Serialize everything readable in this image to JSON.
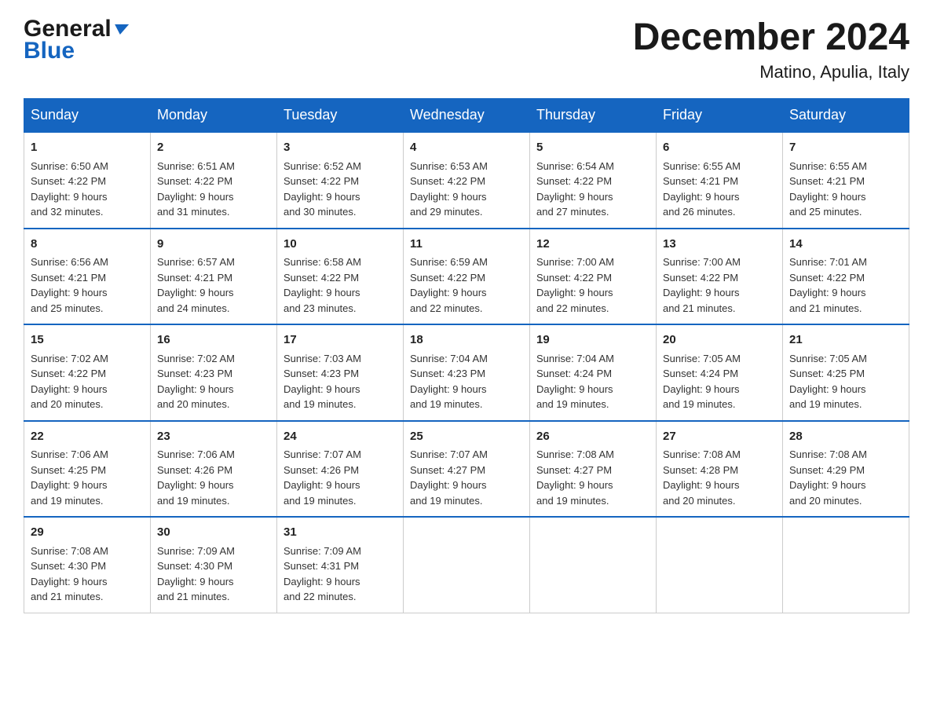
{
  "logo": {
    "line1": "General",
    "line2": "Blue"
  },
  "title": "December 2024",
  "location": "Matino, Apulia, Italy",
  "days_header": [
    "Sunday",
    "Monday",
    "Tuesday",
    "Wednesday",
    "Thursday",
    "Friday",
    "Saturday"
  ],
  "weeks": [
    [
      {
        "day": "1",
        "info": "Sunrise: 6:50 AM\nSunset: 4:22 PM\nDaylight: 9 hours\nand 32 minutes."
      },
      {
        "day": "2",
        "info": "Sunrise: 6:51 AM\nSunset: 4:22 PM\nDaylight: 9 hours\nand 31 minutes."
      },
      {
        "day": "3",
        "info": "Sunrise: 6:52 AM\nSunset: 4:22 PM\nDaylight: 9 hours\nand 30 minutes."
      },
      {
        "day": "4",
        "info": "Sunrise: 6:53 AM\nSunset: 4:22 PM\nDaylight: 9 hours\nand 29 minutes."
      },
      {
        "day": "5",
        "info": "Sunrise: 6:54 AM\nSunset: 4:22 PM\nDaylight: 9 hours\nand 27 minutes."
      },
      {
        "day": "6",
        "info": "Sunrise: 6:55 AM\nSunset: 4:21 PM\nDaylight: 9 hours\nand 26 minutes."
      },
      {
        "day": "7",
        "info": "Sunrise: 6:55 AM\nSunset: 4:21 PM\nDaylight: 9 hours\nand 25 minutes."
      }
    ],
    [
      {
        "day": "8",
        "info": "Sunrise: 6:56 AM\nSunset: 4:21 PM\nDaylight: 9 hours\nand 25 minutes."
      },
      {
        "day": "9",
        "info": "Sunrise: 6:57 AM\nSunset: 4:21 PM\nDaylight: 9 hours\nand 24 minutes."
      },
      {
        "day": "10",
        "info": "Sunrise: 6:58 AM\nSunset: 4:22 PM\nDaylight: 9 hours\nand 23 minutes."
      },
      {
        "day": "11",
        "info": "Sunrise: 6:59 AM\nSunset: 4:22 PM\nDaylight: 9 hours\nand 22 minutes."
      },
      {
        "day": "12",
        "info": "Sunrise: 7:00 AM\nSunset: 4:22 PM\nDaylight: 9 hours\nand 22 minutes."
      },
      {
        "day": "13",
        "info": "Sunrise: 7:00 AM\nSunset: 4:22 PM\nDaylight: 9 hours\nand 21 minutes."
      },
      {
        "day": "14",
        "info": "Sunrise: 7:01 AM\nSunset: 4:22 PM\nDaylight: 9 hours\nand 21 minutes."
      }
    ],
    [
      {
        "day": "15",
        "info": "Sunrise: 7:02 AM\nSunset: 4:22 PM\nDaylight: 9 hours\nand 20 minutes."
      },
      {
        "day": "16",
        "info": "Sunrise: 7:02 AM\nSunset: 4:23 PM\nDaylight: 9 hours\nand 20 minutes."
      },
      {
        "day": "17",
        "info": "Sunrise: 7:03 AM\nSunset: 4:23 PM\nDaylight: 9 hours\nand 19 minutes."
      },
      {
        "day": "18",
        "info": "Sunrise: 7:04 AM\nSunset: 4:23 PM\nDaylight: 9 hours\nand 19 minutes."
      },
      {
        "day": "19",
        "info": "Sunrise: 7:04 AM\nSunset: 4:24 PM\nDaylight: 9 hours\nand 19 minutes."
      },
      {
        "day": "20",
        "info": "Sunrise: 7:05 AM\nSunset: 4:24 PM\nDaylight: 9 hours\nand 19 minutes."
      },
      {
        "day": "21",
        "info": "Sunrise: 7:05 AM\nSunset: 4:25 PM\nDaylight: 9 hours\nand 19 minutes."
      }
    ],
    [
      {
        "day": "22",
        "info": "Sunrise: 7:06 AM\nSunset: 4:25 PM\nDaylight: 9 hours\nand 19 minutes."
      },
      {
        "day": "23",
        "info": "Sunrise: 7:06 AM\nSunset: 4:26 PM\nDaylight: 9 hours\nand 19 minutes."
      },
      {
        "day": "24",
        "info": "Sunrise: 7:07 AM\nSunset: 4:26 PM\nDaylight: 9 hours\nand 19 minutes."
      },
      {
        "day": "25",
        "info": "Sunrise: 7:07 AM\nSunset: 4:27 PM\nDaylight: 9 hours\nand 19 minutes."
      },
      {
        "day": "26",
        "info": "Sunrise: 7:08 AM\nSunset: 4:27 PM\nDaylight: 9 hours\nand 19 minutes."
      },
      {
        "day": "27",
        "info": "Sunrise: 7:08 AM\nSunset: 4:28 PM\nDaylight: 9 hours\nand 20 minutes."
      },
      {
        "day": "28",
        "info": "Sunrise: 7:08 AM\nSunset: 4:29 PM\nDaylight: 9 hours\nand 20 minutes."
      }
    ],
    [
      {
        "day": "29",
        "info": "Sunrise: 7:08 AM\nSunset: 4:30 PM\nDaylight: 9 hours\nand 21 minutes."
      },
      {
        "day": "30",
        "info": "Sunrise: 7:09 AM\nSunset: 4:30 PM\nDaylight: 9 hours\nand 21 minutes."
      },
      {
        "day": "31",
        "info": "Sunrise: 7:09 AM\nSunset: 4:31 PM\nDaylight: 9 hours\nand 22 minutes."
      },
      null,
      null,
      null,
      null
    ]
  ]
}
